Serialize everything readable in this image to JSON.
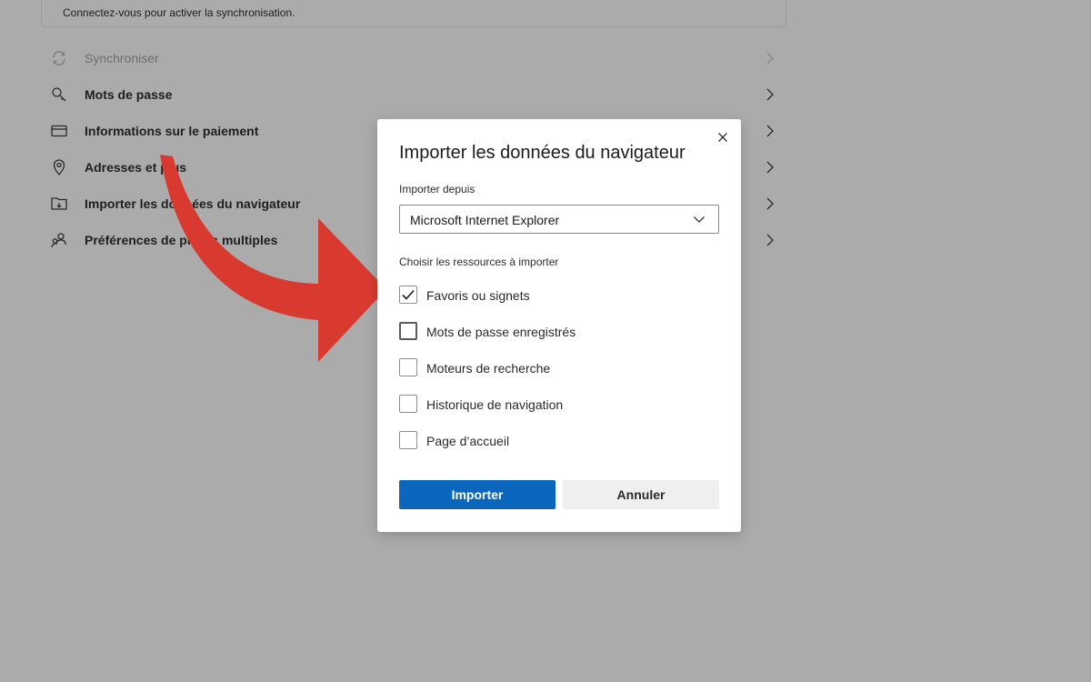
{
  "sync_card": {
    "text": "Connectez-vous pour activer la synchronisation."
  },
  "settings": {
    "items": [
      {
        "label": "Synchroniser",
        "icon": "sync-icon",
        "disabled": true
      },
      {
        "label": "Mots de passe",
        "icon": "key-icon",
        "disabled": false
      },
      {
        "label": "Informations sur le paiement",
        "icon": "credit-card-icon",
        "disabled": false
      },
      {
        "label": "Adresses et plus",
        "icon": "location-pin-icon",
        "disabled": false
      },
      {
        "label": "Importer les données du navigateur",
        "icon": "import-folder-icon",
        "disabled": false
      },
      {
        "label": "Préférences de profils multiples",
        "icon": "profiles-icon",
        "disabled": false
      }
    ]
  },
  "annotation": {
    "arrow_color": "#d93a2f",
    "icon": "red-curved-arrow"
  },
  "dialog": {
    "title": "Importer les données du navigateur",
    "close_icon": "close-icon",
    "source_label": "Importer depuis",
    "source_value": "Microsoft Internet Explorer",
    "resources_label": "Choisir les ressources à importer",
    "options": [
      {
        "label": "Favoris ou signets",
        "checked": true
      },
      {
        "label": "Mots de passe enregistrés",
        "checked": false
      },
      {
        "label": "Moteurs de recherche",
        "checked": false
      },
      {
        "label": "Historique de navigation",
        "checked": false
      },
      {
        "label": "Page d’accueil",
        "checked": false
      }
    ],
    "import_button": "Importer",
    "cancel_button": "Annuler"
  },
  "colors": {
    "overlay_background": "#ababab",
    "primary_button": "#0a67bd",
    "secondary_button": "#efefef"
  }
}
